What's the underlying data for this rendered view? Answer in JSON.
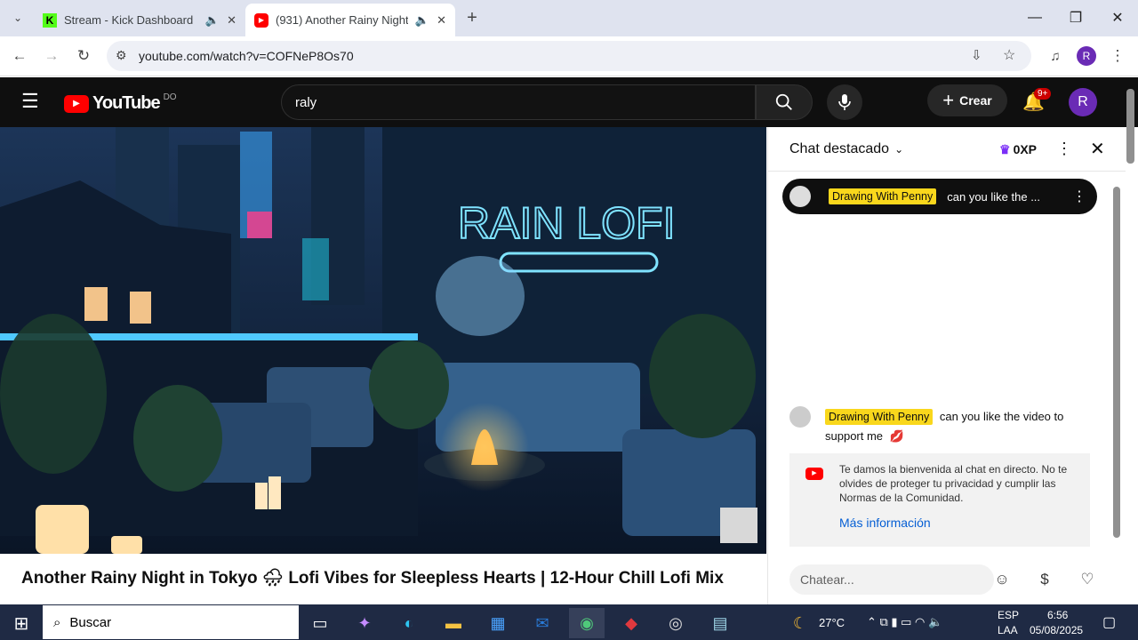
{
  "browser": {
    "tabs": [
      {
        "title": "Stream - Kick Dashboard",
        "active": false
      },
      {
        "title": "(931) Another Rainy Night i",
        "active": true
      }
    ],
    "url": "youtube.com/watch?v=COFNeP8Os70",
    "profile_initial": "R"
  },
  "youtube": {
    "logo_text": "YouTube",
    "region": "DO",
    "search_value": "raly",
    "create_label": "Crear",
    "notif_badge": "9+",
    "avatar_initial": "R"
  },
  "video": {
    "title": "Another Rainy Night in Tokyo 🌧 Lofi Vibes for Sleepless Hearts | 12-Hour Chill Lofi Mix",
    "sign_text": "RAIN LOFI"
  },
  "chat": {
    "header": "Chat destacado",
    "xp": "0XP",
    "pinned": {
      "author": "Drawing With Penny",
      "text": "can you like the ..."
    },
    "message": {
      "author": "Drawing With Penny",
      "text": "can you like the video to support me",
      "emoji": "💋"
    },
    "notice": {
      "text": "Te damos la bienvenida al chat en directo. No te olvides de proteger tu privacidad y cumplir las Normas de la Comunidad.",
      "link": "Más información"
    },
    "input_placeholder": "Chatear..."
  },
  "taskbar": {
    "search_placeholder": "Buscar",
    "weather": "27°C",
    "lang1": "ESP",
    "lang2": "LAA",
    "time": "6:56",
    "date": "05/08/2025"
  },
  "colors": {
    "youtube_red": "#ff0000",
    "kick_green": "#53fc18",
    "chip_yellow": "#f9d71c",
    "link_blue": "#065fd4"
  }
}
